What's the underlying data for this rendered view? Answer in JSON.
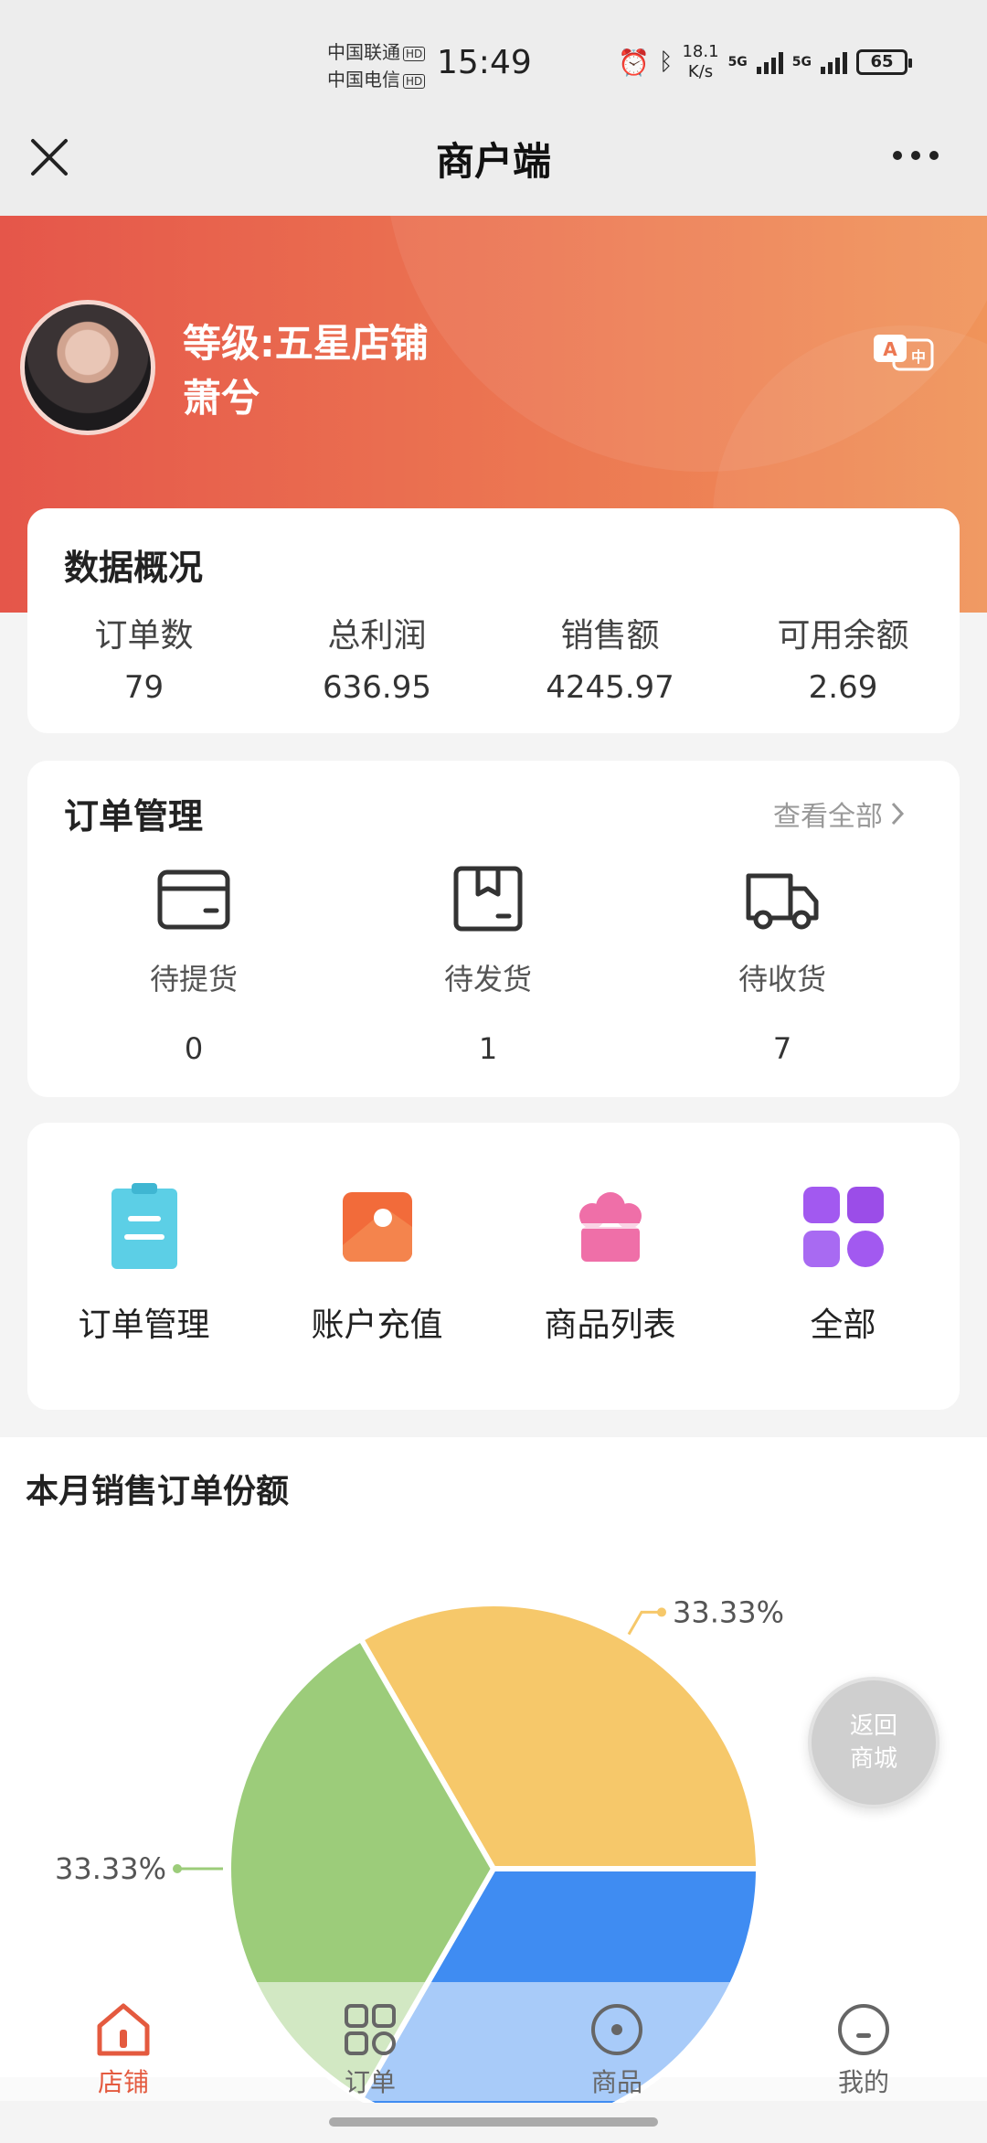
{
  "status_bar": {
    "carrier1": "中国联通",
    "carrier2": "中国电信",
    "hd": "HD",
    "time": "15:49",
    "net_speed_value": "18.1",
    "net_speed_unit": "K/s",
    "signal1": "5G",
    "signal2": "5G",
    "battery": "65"
  },
  "navbar": {
    "title": "商户端"
  },
  "header": {
    "level": "等级:五星店铺",
    "username": "萧兮",
    "lang_icon": "translate-icon"
  },
  "overview": {
    "title": "数据概况",
    "stats": [
      {
        "label": "订单数",
        "value": "79"
      },
      {
        "label": "总利润",
        "value": "636.95"
      },
      {
        "label": "销售额",
        "value": "4245.97"
      },
      {
        "label": "可用余额",
        "value": "2.69"
      }
    ]
  },
  "orders": {
    "title": "订单管理",
    "view_all": "查看全部",
    "items": [
      {
        "label": "待提货",
        "count": "0",
        "icon": "wallet-icon"
      },
      {
        "label": "待发货",
        "count": "1",
        "icon": "box-icon"
      },
      {
        "label": "待收货",
        "count": "7",
        "icon": "truck-icon"
      }
    ]
  },
  "menu": {
    "items": [
      {
        "label": "订单管理",
        "icon": "clipboard-icon",
        "color": "#5ccfe6"
      },
      {
        "label": "账户充值",
        "icon": "recharge-icon",
        "color": "#f26b3a"
      },
      {
        "label": "商品列表",
        "icon": "cupcake-icon",
        "color": "#ef6fa8"
      },
      {
        "label": "全部",
        "icon": "grid-icon",
        "color": "#a259f0"
      }
    ]
  },
  "chart": {
    "title": "本月销售订单份额",
    "labels": [
      "33.33%",
      "33.33%"
    ]
  },
  "chart_data": {
    "type": "pie",
    "title": "本月销售订单份额",
    "values": [
      33.33,
      33.33,
      33.33
    ],
    "colors": [
      "#f6c86a",
      "#3f8cf2",
      "#9ccc7a"
    ],
    "data_labels": [
      "33.33%",
      "",
      "33.33%"
    ]
  },
  "float_button": {
    "line1": "返回",
    "line2": "商城"
  },
  "tabbar": {
    "items": [
      {
        "label": "店铺",
        "icon": "shop-home-icon",
        "active": true
      },
      {
        "label": "订单",
        "icon": "grid-apps-icon",
        "active": false
      },
      {
        "label": "商品",
        "icon": "product-circle-icon",
        "active": false
      },
      {
        "label": "我的",
        "icon": "profile-face-icon",
        "active": false
      }
    ]
  },
  "colors": {
    "accent": "#e45a3f",
    "header_start": "#e5564a",
    "header_end": "#f0945a"
  }
}
